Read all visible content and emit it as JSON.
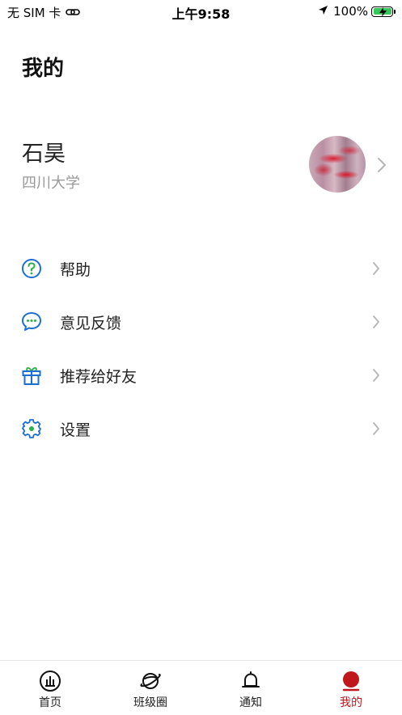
{
  "status_bar": {
    "carrier": "无 SIM 卡",
    "time": "上午9:58",
    "battery": "100%"
  },
  "page": {
    "title": "我的"
  },
  "profile": {
    "name": "石昊",
    "school": "四川大学"
  },
  "menu": [
    {
      "label": "帮助",
      "icon": "help-icon"
    },
    {
      "label": "意见反馈",
      "icon": "feedback-icon"
    },
    {
      "label": "推荐给好友",
      "icon": "gift-icon"
    },
    {
      "label": "设置",
      "icon": "settings-icon"
    }
  ],
  "tabbar": {
    "items": [
      {
        "label": "首页",
        "icon": "home-icon"
      },
      {
        "label": "班级圈",
        "icon": "planet-icon"
      },
      {
        "label": "通知",
        "icon": "bell-icon"
      },
      {
        "label": "我的",
        "icon": "profile-dot-icon"
      }
    ],
    "active_index": 3
  },
  "colors": {
    "accent": "#c0171d",
    "icon_blue": "#1a6fd6",
    "icon_green": "#2bb24c",
    "muted_text": "#999999"
  }
}
